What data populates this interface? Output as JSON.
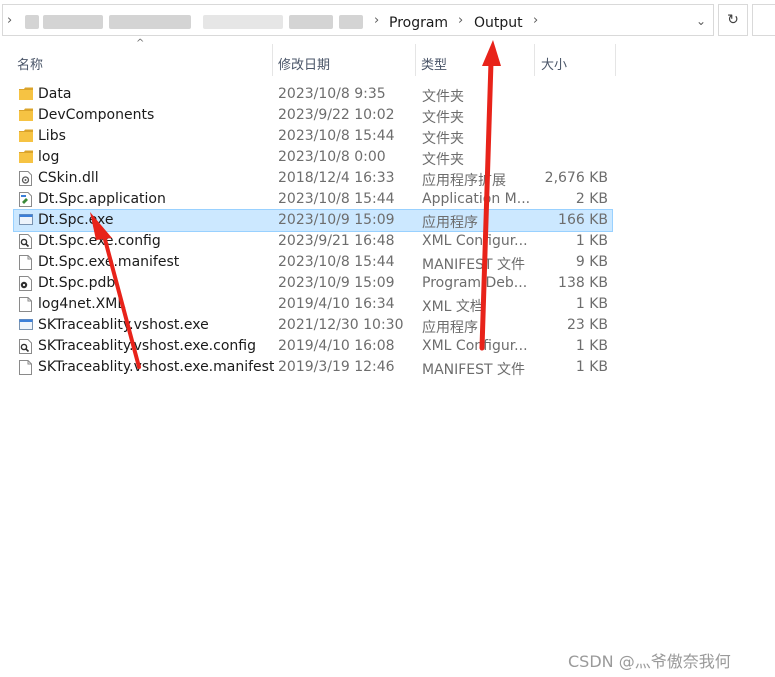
{
  "address": {
    "path": [
      "Program",
      "Output"
    ],
    "refresh_icon": "refresh-icon",
    "dropdown_icon": "chevron-down-icon"
  },
  "columns": {
    "name": "名称",
    "date": "修改日期",
    "type": "类型",
    "size": "大小"
  },
  "files": [
    {
      "name": "Data",
      "date": "2023/10/8 9:35",
      "type": "文件夹",
      "size": "",
      "icon": "folder-icon"
    },
    {
      "name": "DevComponents",
      "date": "2023/9/22 10:02",
      "type": "文件夹",
      "size": "",
      "icon": "folder-icon"
    },
    {
      "name": "Libs",
      "date": "2023/10/8 15:44",
      "type": "文件夹",
      "size": "",
      "icon": "folder-icon"
    },
    {
      "name": "log",
      "date": "2023/10/8 0:00",
      "type": "文件夹",
      "size": "",
      "icon": "folder-icon"
    },
    {
      "name": "CSkin.dll",
      "date": "2018/12/4 16:33",
      "type": "应用程序扩展",
      "size": "2,676 KB",
      "icon": "dll-file-icon"
    },
    {
      "name": "Dt.Spc.application",
      "date": "2023/10/8 15:44",
      "type": "Application M...",
      "size": "2 KB",
      "icon": "application-manifest-icon"
    },
    {
      "name": "Dt.Spc.exe",
      "date": "2023/10/9 15:09",
      "type": "应用程序",
      "size": "166 KB",
      "icon": "exe-icon",
      "selected": true
    },
    {
      "name": "Dt.Spc.exe.config",
      "date": "2023/9/21 16:48",
      "type": "XML Configur...",
      "size": "1 KB",
      "icon": "config-file-icon"
    },
    {
      "name": "Dt.Spc.exe.manifest",
      "date": "2023/10/8 15:44",
      "type": "MANIFEST 文件",
      "size": "9 KB",
      "icon": "blank-file-icon"
    },
    {
      "name": "Dt.Spc.pdb",
      "date": "2023/10/9 15:09",
      "type": "Program Deb...",
      "size": "138 KB",
      "icon": "pdb-file-icon"
    },
    {
      "name": "log4net.XML",
      "date": "2019/4/10 16:34",
      "type": "XML 文档",
      "size": "1 KB",
      "icon": "blank-file-icon"
    },
    {
      "name": "SKTraceablity.vshost.exe",
      "date": "2021/12/30 10:30",
      "type": "应用程序",
      "size": "23 KB",
      "icon": "exe-icon"
    },
    {
      "name": "SKTraceablity.vshost.exe.config",
      "date": "2019/4/10 16:08",
      "type": "XML Configur...",
      "size": "1 KB",
      "icon": "config-file-icon"
    },
    {
      "name": "SKTraceablity.vshost.exe.manifest",
      "date": "2019/3/19 12:46",
      "type": "MANIFEST 文件",
      "size": "1 KB",
      "icon": "blank-file-icon"
    }
  ],
  "watermark": "CSDN @灬爷傲奈我何",
  "colors": {
    "selection_bg": "#cce8ff",
    "selection_border": "#99d1ff",
    "folder": "#f6c343",
    "annotation_arrow": "#e8231a"
  }
}
